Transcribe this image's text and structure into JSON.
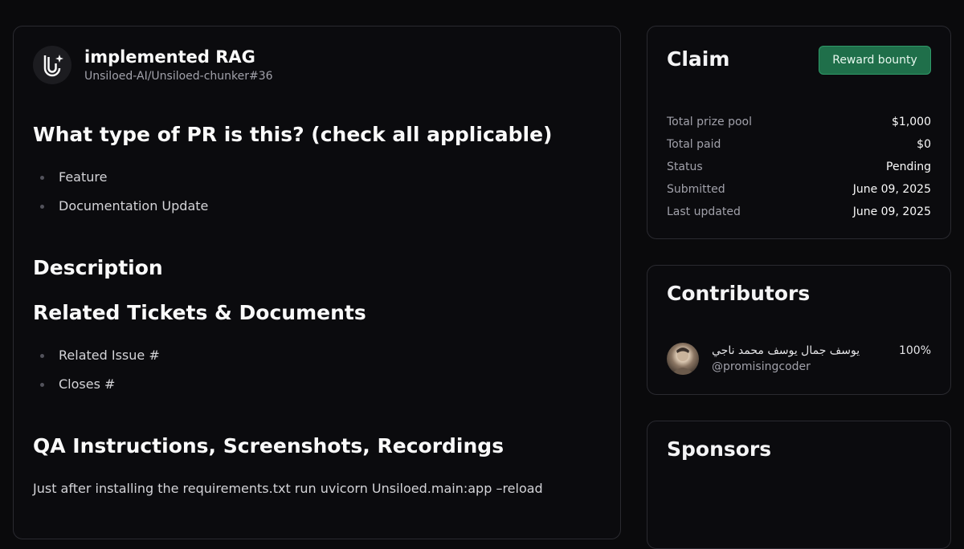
{
  "pr": {
    "title": "implemented RAG",
    "repo": "Unsiloed-AI/Unsiloed-chunker#36"
  },
  "body": {
    "sections": [
      {
        "heading": "What type of PR is this? (check all applicable)",
        "items": [
          "Feature",
          "Documentation Update"
        ]
      },
      {
        "heading": "Description",
        "items": []
      },
      {
        "heading": "Related Tickets & Documents",
        "items": [
          "Related Issue #",
          "Closes #"
        ]
      },
      {
        "heading": "QA Instructions, Screenshots, Recordings",
        "items": []
      }
    ],
    "qa_text": "Just after installing the requirements.txt run uvicorn Unsiloed.main:app –reload"
  },
  "claim": {
    "title": "Claim",
    "button_label": "Reward bounty",
    "stats": [
      {
        "label": "Total prize pool",
        "value": "$1,000"
      },
      {
        "label": "Total paid",
        "value": "$0"
      },
      {
        "label": "Status",
        "value": "Pending"
      },
      {
        "label": "Submitted",
        "value": "June 09, 2025"
      },
      {
        "label": "Last updated",
        "value": "June 09, 2025"
      }
    ]
  },
  "contributors": {
    "title": "Contributors",
    "list": [
      {
        "name": "يوسف جمال يوسف محمد ناجي",
        "handle": "@promisingcoder",
        "share": "100%"
      }
    ]
  },
  "sponsors": {
    "title": "Sponsors"
  },
  "colors": {
    "background": "#0a0a0c",
    "accent": "#1f6f4a"
  }
}
